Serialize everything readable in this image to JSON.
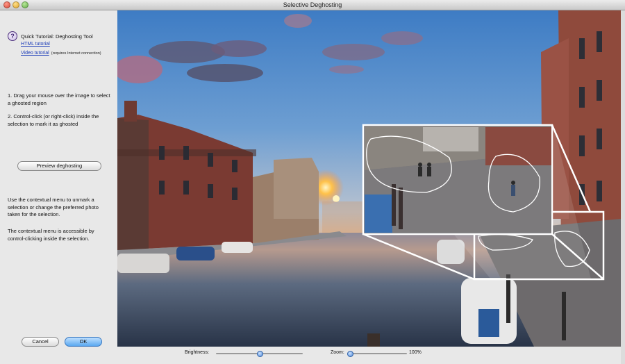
{
  "window": {
    "title": "Selective Deghosting"
  },
  "sidebar": {
    "tutorial_title": "Quick Tutorial: Deghosting Tool",
    "html_tutorial": "HTML tutorial",
    "video_tutorial": "Video tutorial",
    "video_note": "(requires Internet connection)",
    "step1": "1. Drag your mouse over the image to select a ghosted region",
    "step2": "2. Control-click (or right-click) inside the selection to mark it as ghosted",
    "preview_button": "Preview deghosting",
    "para1": "Use the contextual menu to unmark a selection or change the preferred photo taken for the selection.",
    "para2": "The contextual menu is accessible by control-clicking inside the selection.",
    "cancel_button": "Cancel",
    "ok_button": "OK"
  },
  "bottom": {
    "brightness_label": "Brightness:",
    "zoom_label": "Zoom:",
    "zoom_value": "100%"
  },
  "controls": {
    "brightness_level": 0.5,
    "zoom_level": 0.0
  },
  "colors": {
    "accent": "#5aa8f0",
    "link": "#1a3bb8"
  }
}
